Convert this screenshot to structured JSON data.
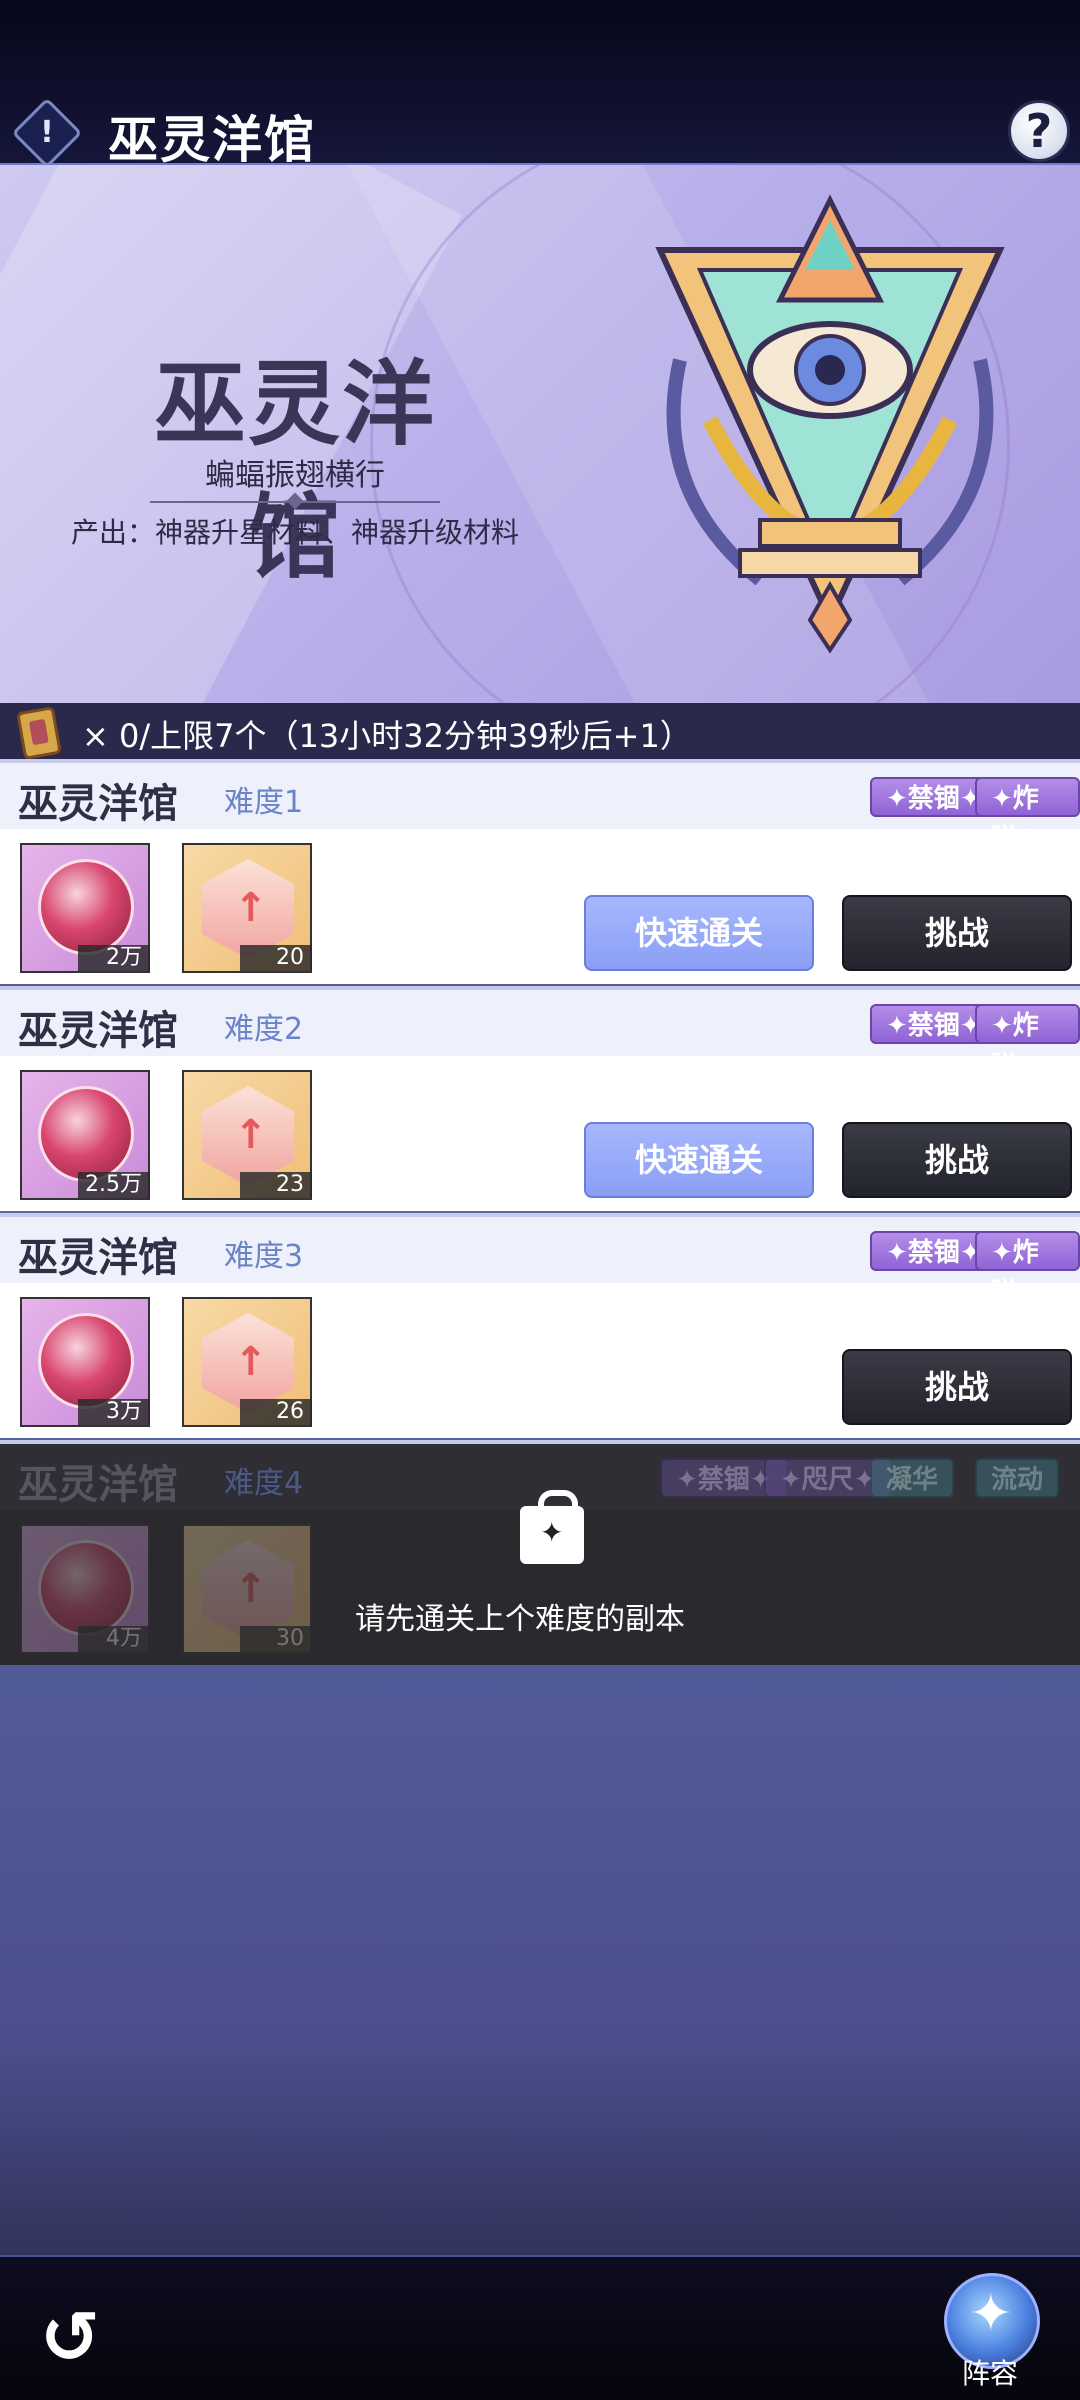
{
  "header": {
    "title": "巫灵洋馆",
    "info_icon": "exclamation-icon",
    "help_label": "?"
  },
  "banner": {
    "title": "巫灵洋馆",
    "subtitle": "蝙蝠振翅横行",
    "output": "产出：神器升星材料、神器升级材料"
  },
  "stamina": {
    "text": "× 0/上限7个（13小时32分钟39秒后+1）"
  },
  "stages": [
    {
      "name": "巫灵洋馆",
      "difficulty": "难度1",
      "tags": [
        "✦禁锢✦",
        "✦炸弹✦"
      ],
      "rewards": [
        "2万",
        "20"
      ],
      "quick_label": "快速通关",
      "challenge_label": "挑战"
    },
    {
      "name": "巫灵洋馆",
      "difficulty": "难度2",
      "tags": [
        "✦禁锢✦",
        "✦炸弹✦"
      ],
      "rewards": [
        "2.5万",
        "23"
      ],
      "quick_label": "快速通关",
      "challenge_label": "挑战"
    },
    {
      "name": "巫灵洋馆",
      "difficulty": "难度3",
      "tags": [
        "✦禁锢✦",
        "✦炸弹✦"
      ],
      "rewards": [
        "3万",
        "26"
      ],
      "challenge_label": "挑战"
    },
    {
      "name": "巫灵洋馆",
      "difficulty": "难度4",
      "tags": [
        "✦禁锢✦",
        "✦咫尺✦",
        "凝华",
        "流动"
      ],
      "rewards": [
        "4万",
        "30"
      ],
      "locked_text": "请先通关上个难度的副本"
    }
  ],
  "bottom": {
    "back_icon": "back-arrow-icon",
    "team_label": "阵容"
  },
  "colors": {
    "accent": "#8a9ef4",
    "dark_button": "#22232c",
    "tag_purple": "#8f63d6"
  }
}
